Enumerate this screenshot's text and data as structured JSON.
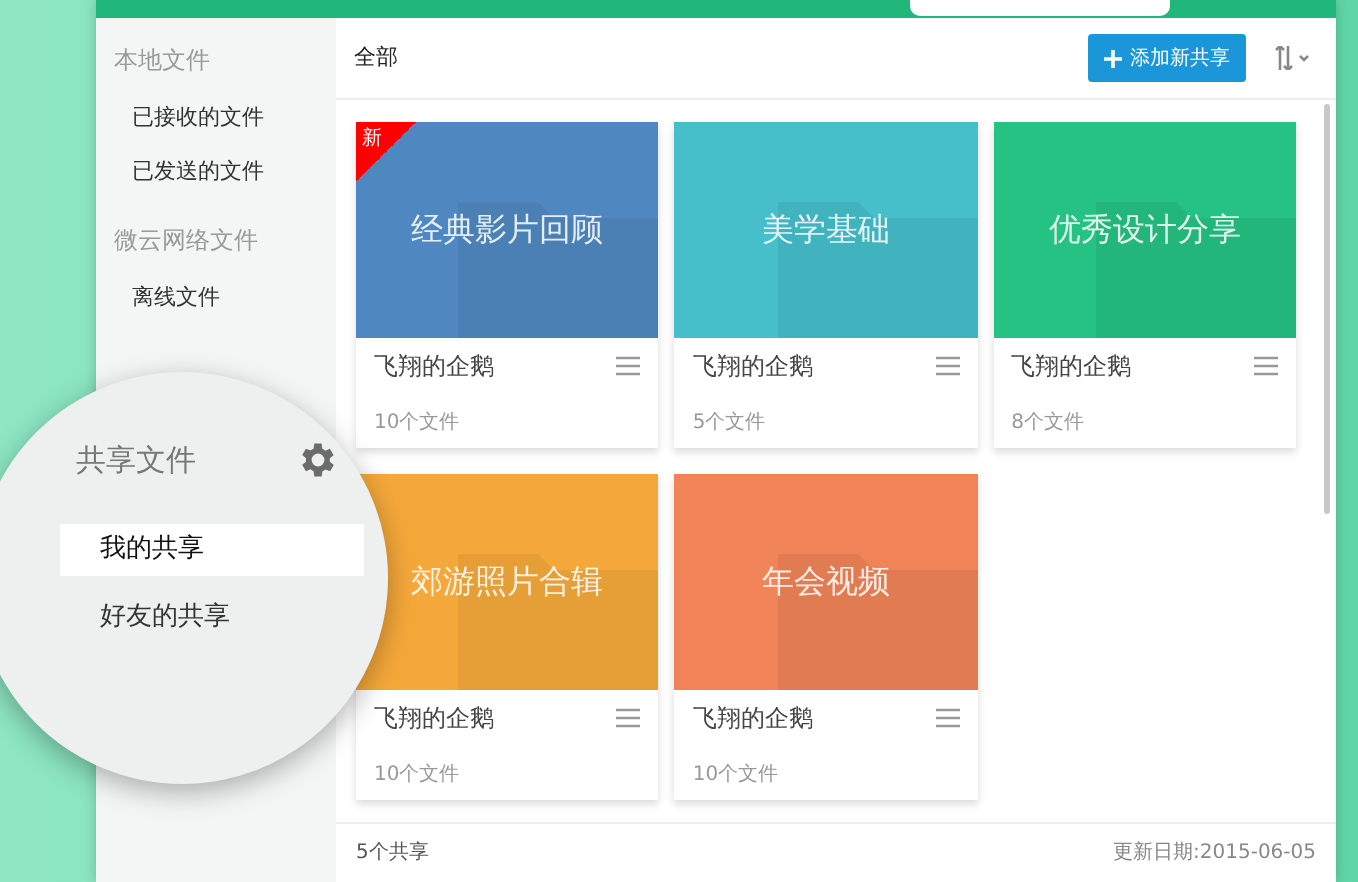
{
  "sidebar": {
    "sections": [
      {
        "title": "本地文件",
        "items": [
          {
            "label": "已接收的文件"
          },
          {
            "label": "已发送的文件"
          }
        ]
      },
      {
        "title": "微云网络文件",
        "items": [
          {
            "label": "离线文件"
          }
        ]
      }
    ]
  },
  "magnifier": {
    "title": "共享文件",
    "items": [
      {
        "label": "我的共享",
        "selected": true
      },
      {
        "label": "好友的共享",
        "selected": false
      }
    ]
  },
  "toolbar": {
    "filter": "全部",
    "add_button": "添加新共享"
  },
  "cards": [
    {
      "title": "经典影片回顾",
      "color": "#4f88c0",
      "badge": "新",
      "owner": "飞翔的企鹅",
      "count": "10个文件"
    },
    {
      "title": "美学基础",
      "color": "#46bfca",
      "owner": "飞翔的企鹅",
      "count": "5个文件"
    },
    {
      "title": "优秀设计分享",
      "color": "#26c283",
      "owner": "飞翔的企鹅",
      "count": "8个文件"
    },
    {
      "title": "郊游照片合辑",
      "color": "#f5a83a",
      "owner": "飞翔的企鹅",
      "count": "10个文件"
    },
    {
      "title": "年会视频",
      "color": "#f08458",
      "owner": "飞翔的企鹅",
      "count": "10个文件"
    }
  ],
  "status_bar": {
    "count": "5个共享",
    "updated": "更新日期:2015-06-05"
  }
}
